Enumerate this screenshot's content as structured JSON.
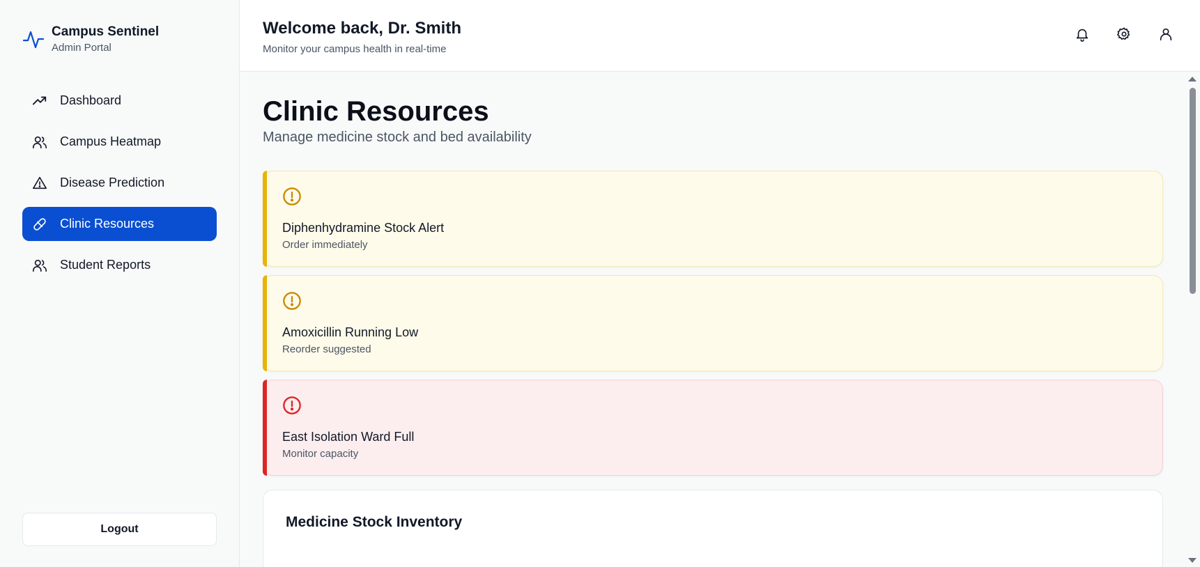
{
  "brand": {
    "title": "Campus Sentinel",
    "subtitle": "Admin Portal",
    "icon": "pulse-icon"
  },
  "sidebar": {
    "items": [
      {
        "label": "Dashboard",
        "icon": "trending-up-icon",
        "active": false
      },
      {
        "label": "Campus Heatmap",
        "icon": "users-icon",
        "active": false
      },
      {
        "label": "Disease Prediction",
        "icon": "alert-triangle-icon",
        "active": false
      },
      {
        "label": "Clinic Resources",
        "icon": "pill-icon",
        "active": true
      },
      {
        "label": "Student Reports",
        "icon": "users-icon",
        "active": false
      }
    ],
    "logout_label": "Logout"
  },
  "header": {
    "welcome": "Welcome back, Dr. Smith",
    "subtitle": "Monitor your campus health in real-time",
    "icons": [
      "bell-icon",
      "gear-icon",
      "user-icon"
    ]
  },
  "page": {
    "title": "Clinic Resources",
    "subtitle": "Manage medicine stock and bed availability"
  },
  "alerts": [
    {
      "title": "Diphenhydramine Stock Alert",
      "description": "Order immediately",
      "severity": "warning",
      "icon": "alert-circle-icon"
    },
    {
      "title": "Amoxicillin Running Low",
      "description": "Reorder suggested",
      "severity": "warning",
      "icon": "alert-circle-icon"
    },
    {
      "title": "East Isolation Ward Full",
      "description": "Monitor capacity",
      "severity": "critical",
      "icon": "alert-circle-icon"
    }
  ],
  "inventory": {
    "title": "Medicine Stock Inventory"
  },
  "colors": {
    "accent": "#0a4fd1",
    "warning": "#e9b308",
    "warning_bg": "#fefbea",
    "critical": "#dc2626",
    "critical_bg": "#fcedee"
  }
}
